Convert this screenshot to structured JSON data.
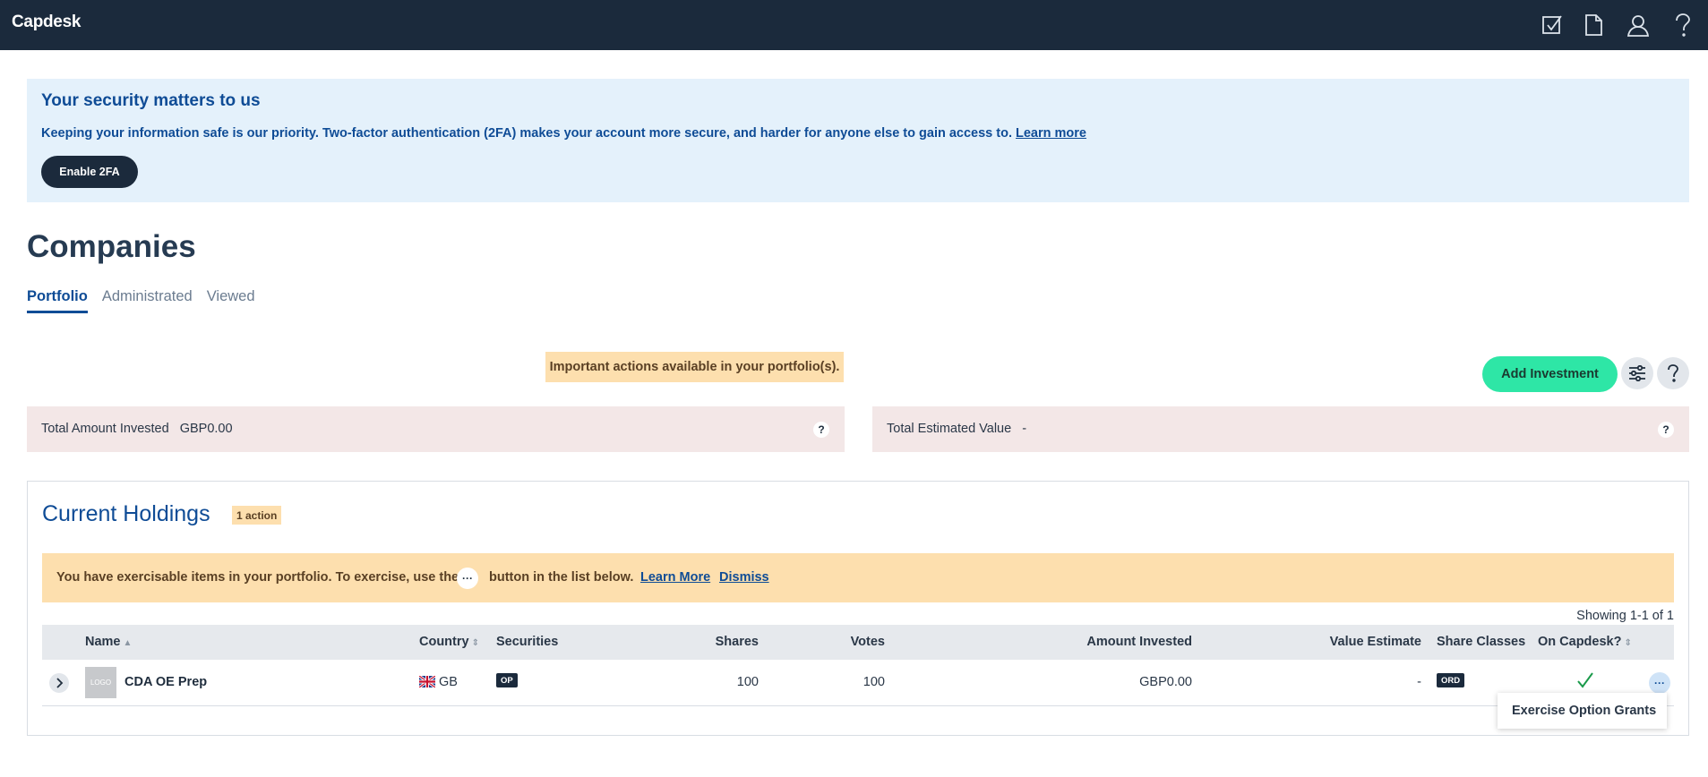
{
  "app": {
    "logo": "Capdesk"
  },
  "topbar": {
    "icons": [
      "tasks-check-icon",
      "document-icon",
      "user-icon",
      "help-icon"
    ]
  },
  "security": {
    "title": "Your security matters to us",
    "text": "Keeping your information safe is our priority. Two-factor authentication (2FA) makes your account more secure, and harder for anyone else to gain access to.",
    "learn_more": "Learn more",
    "button": "Enable 2FA"
  },
  "page": {
    "title": "Companies"
  },
  "tabs": [
    {
      "label": "Portfolio",
      "active": true
    },
    {
      "label": "Administrated",
      "active": false
    },
    {
      "label": "Viewed",
      "active": false
    }
  ],
  "actions_note": "Important actions available in your portfolio(s).",
  "toolbar": {
    "add_investment": "Add Investment",
    "filter_icon": "sliders-icon",
    "help_icon": "help-icon"
  },
  "stats": {
    "invested_label": "Total Amount Invested",
    "invested_value": "GBP0.00",
    "estimated_label": "Total Estimated Value",
    "estimated_value": "-",
    "help": "?"
  },
  "holdings": {
    "title": "Current Holdings",
    "badge": "1 action",
    "banner": {
      "text_before": "You have exercisable items in your portfolio. To exercise, use the",
      "dots": "···",
      "text_after": "button in the list below.",
      "learn_more": "Learn More",
      "dismiss": "Dismiss"
    },
    "showing": "Showing 1-1 of 1",
    "columns": {
      "name": "Name",
      "country": "Country",
      "securities": "Securities",
      "shares": "Shares",
      "votes": "Votes",
      "amount_invested": "Amount Invested",
      "value_estimate": "Value Estimate",
      "share_classes": "Share Classes",
      "on_capdesk": "On Capdesk?"
    },
    "rows": [
      {
        "logo": "LOGO",
        "name": "CDA OE Prep",
        "country": "GB",
        "securities": "OP",
        "shares": "100",
        "votes": "100",
        "amount_invested": "GBP0.00",
        "value_estimate": "-",
        "share_classes": "ORD",
        "on_capdesk": true,
        "dots": "···"
      }
    ],
    "menu": {
      "items": [
        "Exercise Option Grants"
      ]
    }
  },
  "colors": {
    "navy": "#1b2a3c",
    "brand_blue": "#0f4c96",
    "mint": "#2ee6a6",
    "warning": "#fddfae",
    "check_green": "#1a9a4a"
  }
}
